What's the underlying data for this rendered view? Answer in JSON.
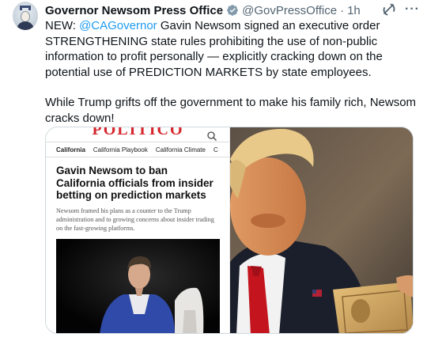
{
  "tweet": {
    "display_name": "Governor Newsom Press Office",
    "handle": "@GovPressOffice",
    "separator": "·",
    "time": "1h",
    "more": "···",
    "line1_prefix": "NEW: ",
    "mention": "@CAGovernor",
    "line1_rest": " Gavin Newsom signed an executive order STRENGTHENING state rules prohibiting the use of non-public information to profit personally — explicitly cracking down on the potential use of PREDICTION MARKETS by state employees.",
    "paragraph2": "While Trump grifts off the government to make his family rich, Newsom cracks down!"
  },
  "article": {
    "logo": "POLITICO",
    "nav": [
      "California",
      "California Playbook",
      "California Climate",
      "C"
    ],
    "headline": "Gavin Newsom to ban California officials from insider betting on prediction markets",
    "dek": "Newsom framed his plans as a counter to the Trump administration and to growing concerns about insider trading on the fast-growing platforms."
  },
  "colors": {
    "accent": "#1d9bf0",
    "politico_red": "#d5262d",
    "verified_gray": "#829aab",
    "secondary_text": "#536471"
  },
  "icons": {
    "verified": "verified-badge-icon",
    "grok": "grok-icon",
    "more": "more-icon",
    "search": "search-icon"
  }
}
